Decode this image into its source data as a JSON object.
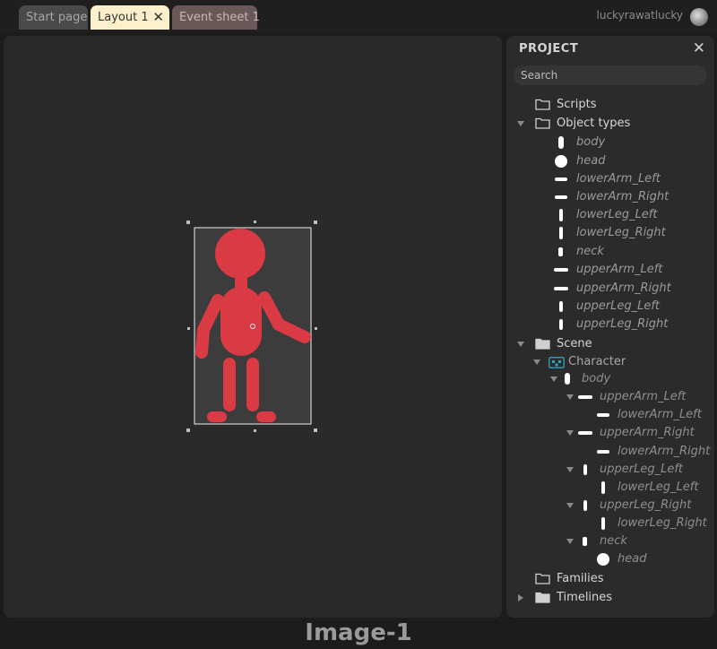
{
  "tabs": [
    {
      "label": "Start page"
    },
    {
      "label": "Layout 1",
      "close": "✕"
    },
    {
      "label": "Event sheet 1"
    }
  ],
  "user": {
    "name": "luckyrawatlucky"
  },
  "project": {
    "title": "PROJECT",
    "close": "✕",
    "search_placeholder": "Search",
    "folders": {
      "scripts": "Scripts",
      "object_types": "Object types",
      "scene": "Scene",
      "families": "Families",
      "timelines": "Timelines"
    },
    "object_types": [
      "body",
      "head",
      "lowerArm_Left",
      "lowerArm_Right",
      "lowerLeg_Left",
      "lowerLeg_Right",
      "neck",
      "upperArm_Left",
      "upperArm_Right",
      "upperLeg_Left",
      "upperLeg_Right"
    ],
    "scene": {
      "character": "Character",
      "body": "body",
      "upperArm_Left": "upperArm_Left",
      "lowerArm_Left": "lowerArm_Left",
      "upperArm_Right": "upperArm_Right",
      "lowerArm_Right": "lowerArm_Right",
      "upperLeg_Left": "upperLeg_Left",
      "lowerLeg_Left": "lowerLeg_Left",
      "upperLeg_Right": "upperLeg_Right",
      "lowerLeg_Right": "lowerLeg_Right",
      "neck": "neck",
      "head": "head"
    }
  },
  "colors": {
    "character": "#d93a44",
    "layout_tab": "#fcefcb",
    "event_tab": "#6a5858"
  },
  "caption": "Image-1"
}
